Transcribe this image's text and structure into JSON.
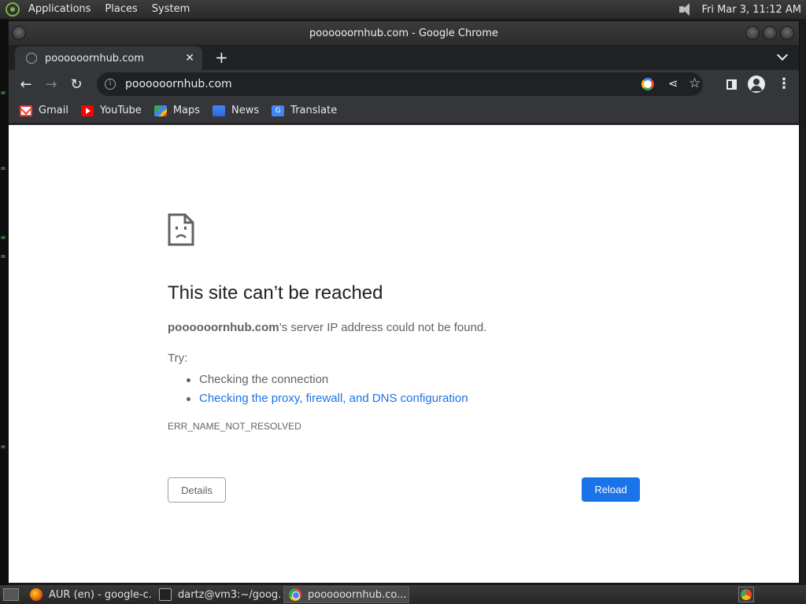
{
  "top_panel": {
    "menus": [
      "Applications",
      "Places",
      "System"
    ],
    "clock": "Fri Mar  3, 11:12 AM"
  },
  "window": {
    "title": "poooooornhub.com - Google Chrome"
  },
  "tab": {
    "title": "poooooornhub.com",
    "close_glyph": "✕",
    "new_tab_glyph": "+"
  },
  "toolbar": {
    "back_glyph": "←",
    "forward_glyph": "→",
    "reload_glyph": "↻",
    "url": "poooooornhub.com",
    "info_glyph": "i",
    "share_glyph": "⋖",
    "star_glyph": "☆",
    "menu_glyph": "⋮"
  },
  "bookmarks": [
    {
      "label": "Gmail",
      "icon": "gmail-icon"
    },
    {
      "label": "YouTube",
      "icon": "youtube-icon"
    },
    {
      "label": "Maps",
      "icon": "maps-icon"
    },
    {
      "label": "News",
      "icon": "news-icon"
    },
    {
      "label": "Translate",
      "icon": "translate-icon"
    }
  ],
  "error_page": {
    "title": "This site can’t be reached",
    "host": "poooooornhub.com",
    "description_suffix": "’s server IP address could not be found.",
    "try_label": "Try:",
    "suggestions": [
      "Checking the connection",
      "Checking the proxy, firewall, and DNS configuration"
    ],
    "error_code": "ERR_NAME_NOT_RESOLVED",
    "details_label": "Details",
    "reload_label": "Reload"
  },
  "taskbar": {
    "tasks": [
      {
        "label": "AUR (en) - google-c...",
        "icon": "firefox-icon"
      },
      {
        "label": "dartz@vm3:~/goog...",
        "icon": "terminal-icon"
      },
      {
        "label": "poooooornhub.co...",
        "icon": "chrome-icon"
      }
    ]
  },
  "colors": {
    "accent_blue": "#1a73e8",
    "chrome_toolbar": "#35363a",
    "chrome_tabstrip": "#202124",
    "error_text": "#5f6368"
  }
}
